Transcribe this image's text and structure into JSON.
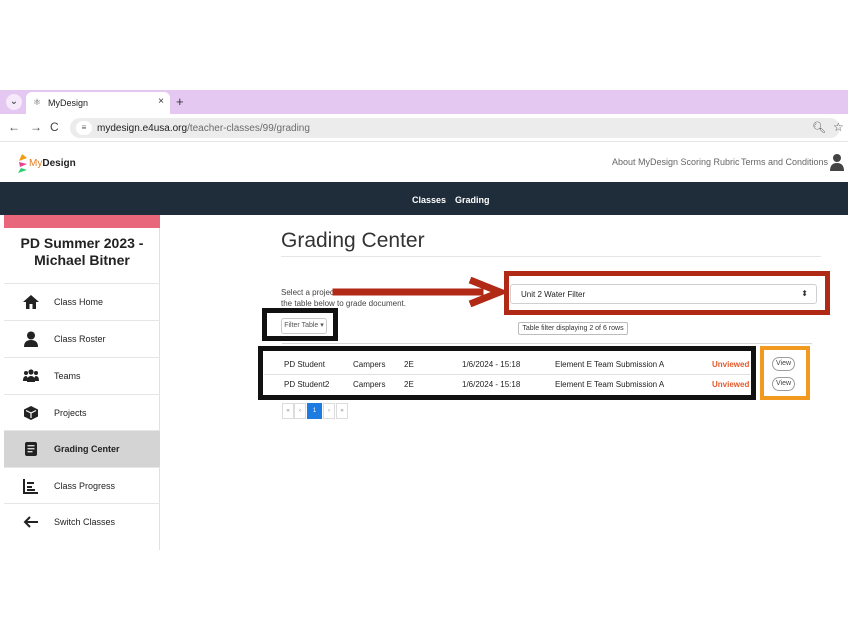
{
  "browser": {
    "tab_title": "MyDesign",
    "tab_close": "×",
    "new_tab": "+",
    "url_host": "mydesign.e4usa.org",
    "url_path": "/teacher-classes/99/grading"
  },
  "header": {
    "logo_my": "My",
    "logo_design": "Design",
    "links": [
      "About MyDesign Scoring Rubric",
      "Terms and Conditions"
    ]
  },
  "navbar": {
    "items": [
      "Classes",
      "Grading"
    ]
  },
  "sidebar": {
    "title": "PD Summer 2023 - Michael Bitner",
    "items": [
      {
        "label": "Class Home",
        "icon": "home-icon"
      },
      {
        "label": "Class Roster",
        "icon": "person-icon"
      },
      {
        "label": "Teams",
        "icon": "people-icon"
      },
      {
        "label": "Projects",
        "icon": "box-icon"
      },
      {
        "label": "Grading Center",
        "icon": "document-icon",
        "active": true
      },
      {
        "label": "Class Progress",
        "icon": "chart-icon"
      },
      {
        "label": "Switch Classes",
        "icon": "arrow-left-icon"
      }
    ]
  },
  "main": {
    "title": "Grading Center",
    "instructions_visible_start": "Select a project",
    "instructions_line2": "the table below to grade document.",
    "project_select_value": "Unit 2 Water Filter",
    "filter_button": "Filter Table ▾",
    "filter_status": "Table filter displaying 2 of 6 rows",
    "rows": [
      {
        "student": "PD Student",
        "team": "Campers",
        "element": "2E",
        "date": "1/6/2024 - 15:18",
        "submission": "Element E Team Submission A",
        "status": "Unviewed",
        "action": "View"
      },
      {
        "student": "PD Student2",
        "team": "Campers",
        "element": "2E",
        "date": "1/6/2024 - 15:18",
        "submission": "Element E Team Submission A",
        "status": "Unviewed",
        "action": "View"
      }
    ],
    "pager": [
      "«",
      "‹",
      "1",
      "›",
      "»"
    ]
  },
  "colors": {
    "tabstrip": "#e5c8f2",
    "navbar": "#1f2d3a",
    "sidebar_accent": "#e8677a",
    "status_unviewed": "#e55b2e",
    "annotation_red": "#b02a15",
    "annotation_black": "#111111",
    "annotation_orange": "#f29a1f"
  }
}
